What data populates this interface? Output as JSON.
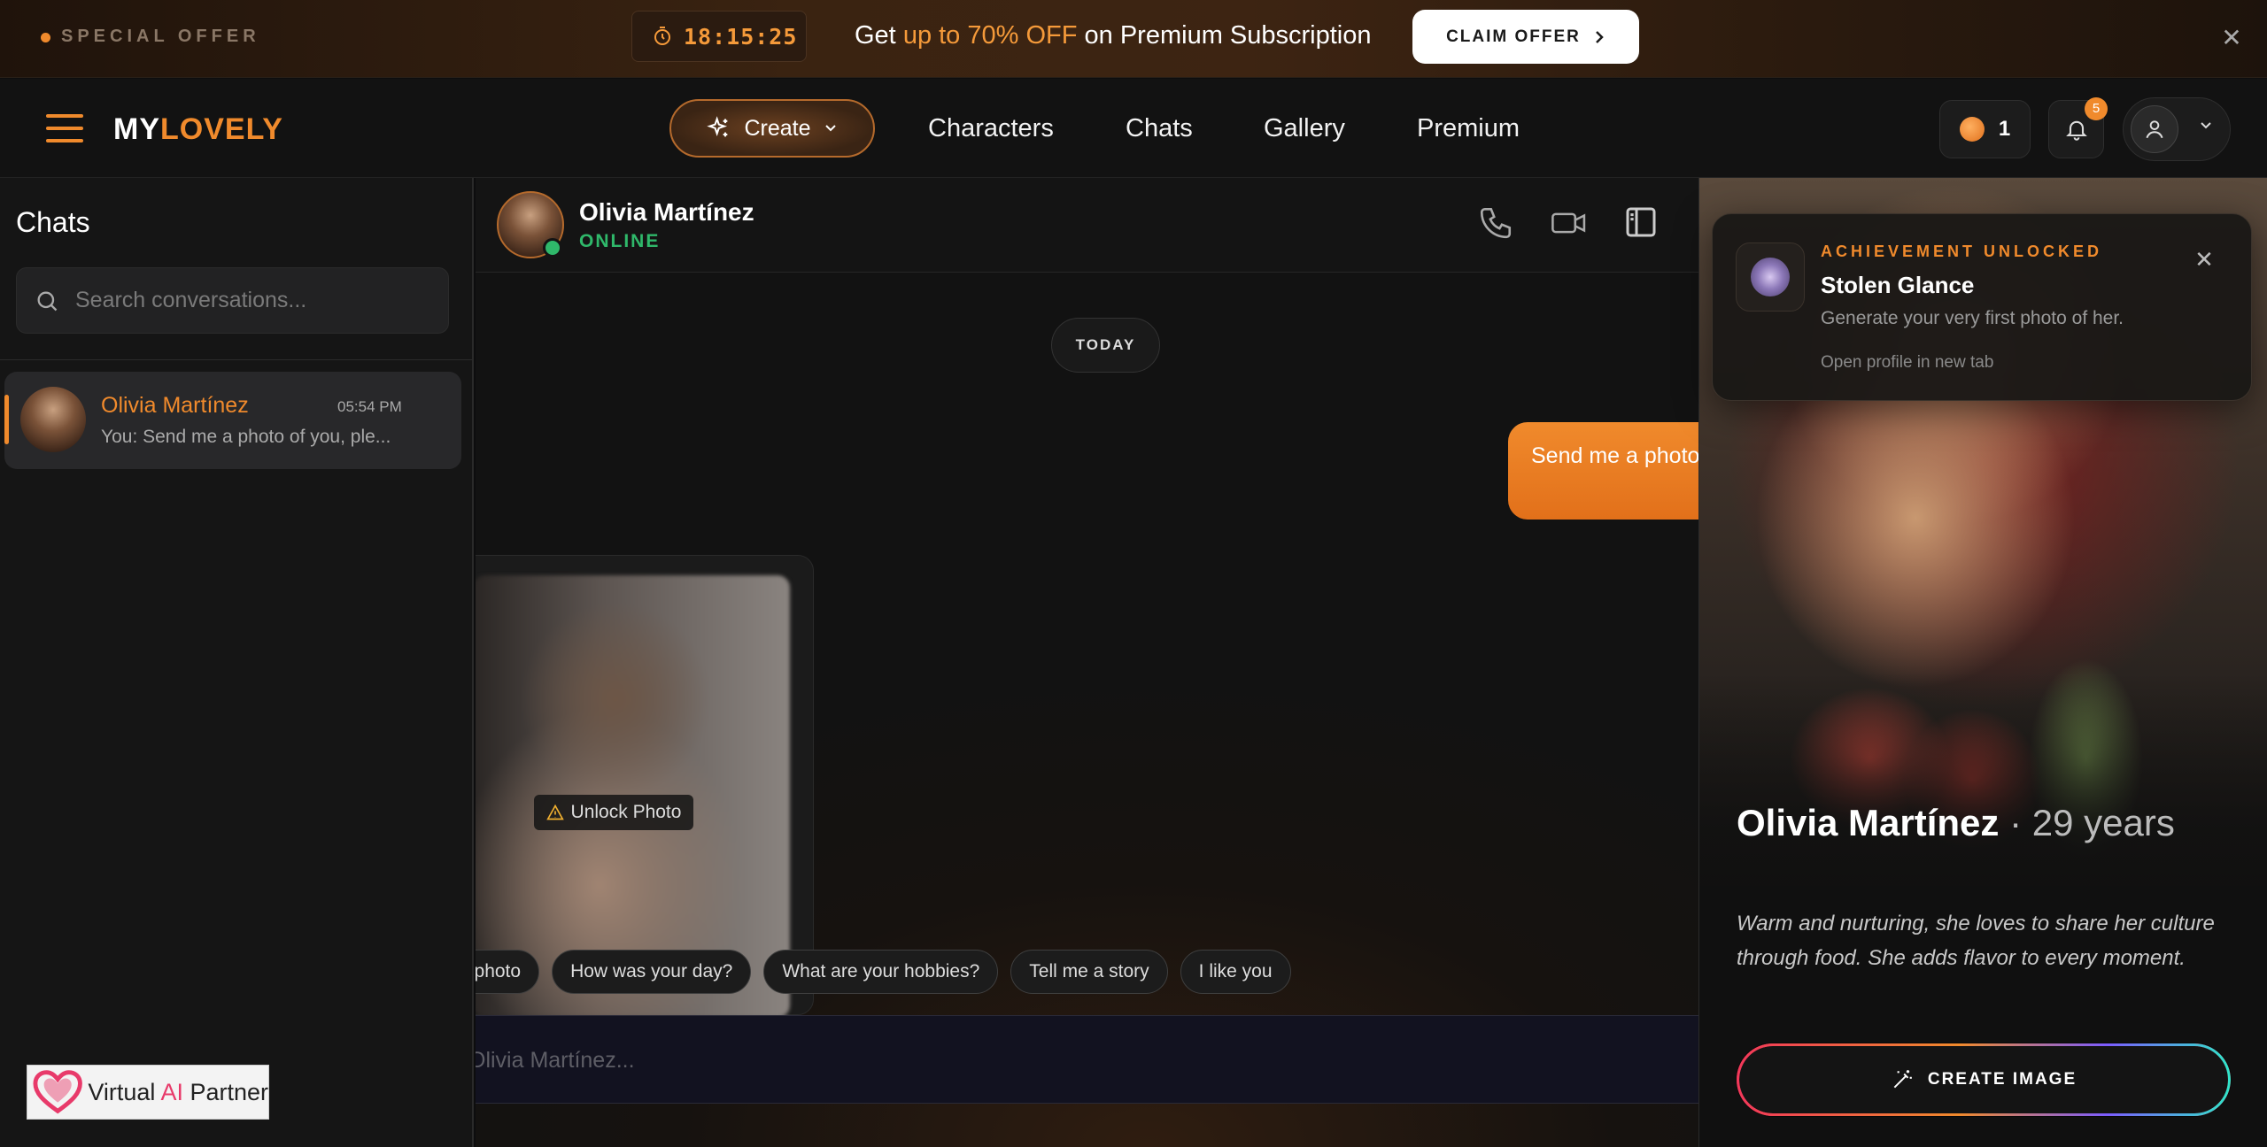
{
  "promo": {
    "label": "SPECIAL OFFER",
    "timer": "18:15:25",
    "text_before": "Get ",
    "text_highlight": "up to 70% OFF",
    "text_after": " on Premium Subscription",
    "cta": "CLAIM OFFER"
  },
  "nav": {
    "logo_part1": "MY",
    "logo_part2": "LOVELY",
    "create": "Create",
    "links": [
      "Characters",
      "Chats",
      "Gallery",
      "Premium"
    ],
    "coins": "1",
    "notifications": "5"
  },
  "sidebar": {
    "title": "Chats",
    "search_placeholder": "Search conversations...",
    "conversations": [
      {
        "name": "Olivia Martínez",
        "time": "05:54 PM",
        "preview": "You: Send me a photo of you, ple..."
      }
    ],
    "watermark_a": "Virtual ",
    "watermark_ai": "AI",
    "watermark_b": " Partner"
  },
  "chat": {
    "name": "Olivia Martínez",
    "status": "ONLINE",
    "date_divider": "TODAY",
    "outgoing_message": "Send me a photo",
    "unlock_label": "Unlock Photo",
    "suggestions": [
      "n photo",
      "How was your day?",
      "What are your hobbies?",
      "Tell me a story",
      "I like you"
    ],
    "input_placeholder": "Olivia Martínez..."
  },
  "profile": {
    "name": "Olivia Martínez",
    "age": " · 29 years",
    "description": "Warm and nurturing, she loves to share her culture through food. She adds flavor to every moment.",
    "cta": "CREATE IMAGE"
  },
  "achievement": {
    "kicker": "ACHIEVEMENT UNLOCKED",
    "title": "Stolen Glance",
    "description": "Generate your very first photo of her.",
    "link": "Open profile in new tab"
  },
  "colors": {
    "accent": "#f08a2c",
    "online": "#2fb86a",
    "cta_border": "#f2385a"
  }
}
